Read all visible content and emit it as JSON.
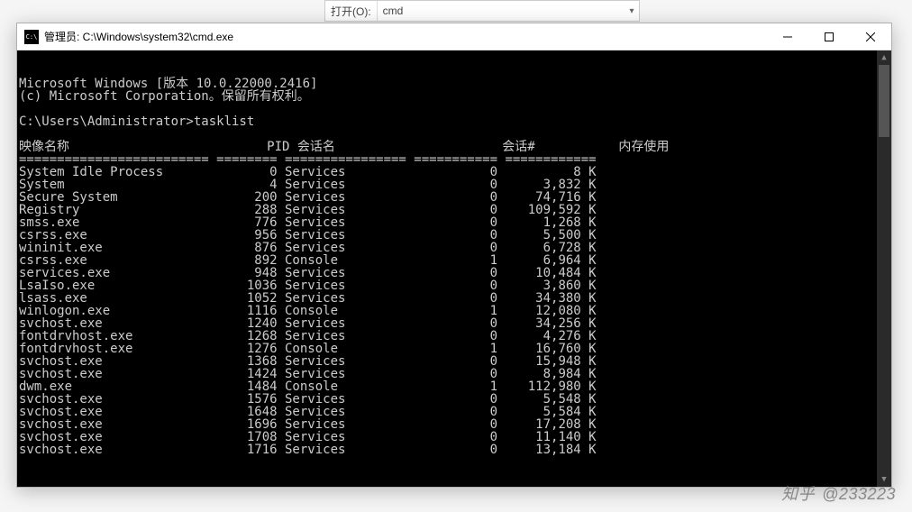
{
  "bg_dialog": {
    "label": "打开(O):",
    "value": "cmd"
  },
  "window": {
    "title": "管理员: C:\\Windows\\system32\\cmd.exe"
  },
  "terminal": {
    "banner1": "Microsoft Windows [版本 10.0.22000.2416]",
    "banner2": "(c) Microsoft Corporation。保留所有权利。",
    "prompt": "C:\\Users\\Administrator>",
    "command": "tasklist",
    "headers": {
      "image": "映像名称",
      "pid": "PID",
      "session_name": "会话名",
      "session_num": "会话#",
      "mem": "内存使用"
    },
    "divider": "========================= ======== ================ =========== ============",
    "rows": [
      {
        "image": "System Idle Process",
        "pid": 0,
        "session": "Services",
        "snum": 0,
        "mem": "8 K"
      },
      {
        "image": "System",
        "pid": 4,
        "session": "Services",
        "snum": 0,
        "mem": "3,832 K"
      },
      {
        "image": "Secure System",
        "pid": 200,
        "session": "Services",
        "snum": 0,
        "mem": "74,716 K"
      },
      {
        "image": "Registry",
        "pid": 288,
        "session": "Services",
        "snum": 0,
        "mem": "109,592 K"
      },
      {
        "image": "smss.exe",
        "pid": 776,
        "session": "Services",
        "snum": 0,
        "mem": "1,268 K"
      },
      {
        "image": "csrss.exe",
        "pid": 956,
        "session": "Services",
        "snum": 0,
        "mem": "5,500 K"
      },
      {
        "image": "wininit.exe",
        "pid": 876,
        "session": "Services",
        "snum": 0,
        "mem": "6,728 K"
      },
      {
        "image": "csrss.exe",
        "pid": 892,
        "session": "Console",
        "snum": 1,
        "mem": "6,964 K"
      },
      {
        "image": "services.exe",
        "pid": 948,
        "session": "Services",
        "snum": 0,
        "mem": "10,484 K"
      },
      {
        "image": "LsaIso.exe",
        "pid": 1036,
        "session": "Services",
        "snum": 0,
        "mem": "3,860 K"
      },
      {
        "image": "lsass.exe",
        "pid": 1052,
        "session": "Services",
        "snum": 0,
        "mem": "34,380 K"
      },
      {
        "image": "winlogon.exe",
        "pid": 1116,
        "session": "Console",
        "snum": 1,
        "mem": "12,080 K"
      },
      {
        "image": "svchost.exe",
        "pid": 1240,
        "session": "Services",
        "snum": 0,
        "mem": "34,256 K"
      },
      {
        "image": "fontdrvhost.exe",
        "pid": 1268,
        "session": "Services",
        "snum": 0,
        "mem": "4,276 K"
      },
      {
        "image": "fontdrvhost.exe",
        "pid": 1276,
        "session": "Console",
        "snum": 1,
        "mem": "16,760 K"
      },
      {
        "image": "svchost.exe",
        "pid": 1368,
        "session": "Services",
        "snum": 0,
        "mem": "15,948 K"
      },
      {
        "image": "svchost.exe",
        "pid": 1424,
        "session": "Services",
        "snum": 0,
        "mem": "8,984 K"
      },
      {
        "image": "dwm.exe",
        "pid": 1484,
        "session": "Console",
        "snum": 1,
        "mem": "112,980 K"
      },
      {
        "image": "svchost.exe",
        "pid": 1576,
        "session": "Services",
        "snum": 0,
        "mem": "5,548 K"
      },
      {
        "image": "svchost.exe",
        "pid": 1648,
        "session": "Services",
        "snum": 0,
        "mem": "5,584 K"
      },
      {
        "image": "svchost.exe",
        "pid": 1696,
        "session": "Services",
        "snum": 0,
        "mem": "17,208 K"
      },
      {
        "image": "svchost.exe",
        "pid": 1708,
        "session": "Services",
        "snum": 0,
        "mem": "11,140 K"
      },
      {
        "image": "svchost.exe",
        "pid": 1716,
        "session": "Services",
        "snum": 0,
        "mem": "13,184 K"
      }
    ]
  },
  "watermark": {
    "site": "知乎",
    "user": "@233223"
  }
}
